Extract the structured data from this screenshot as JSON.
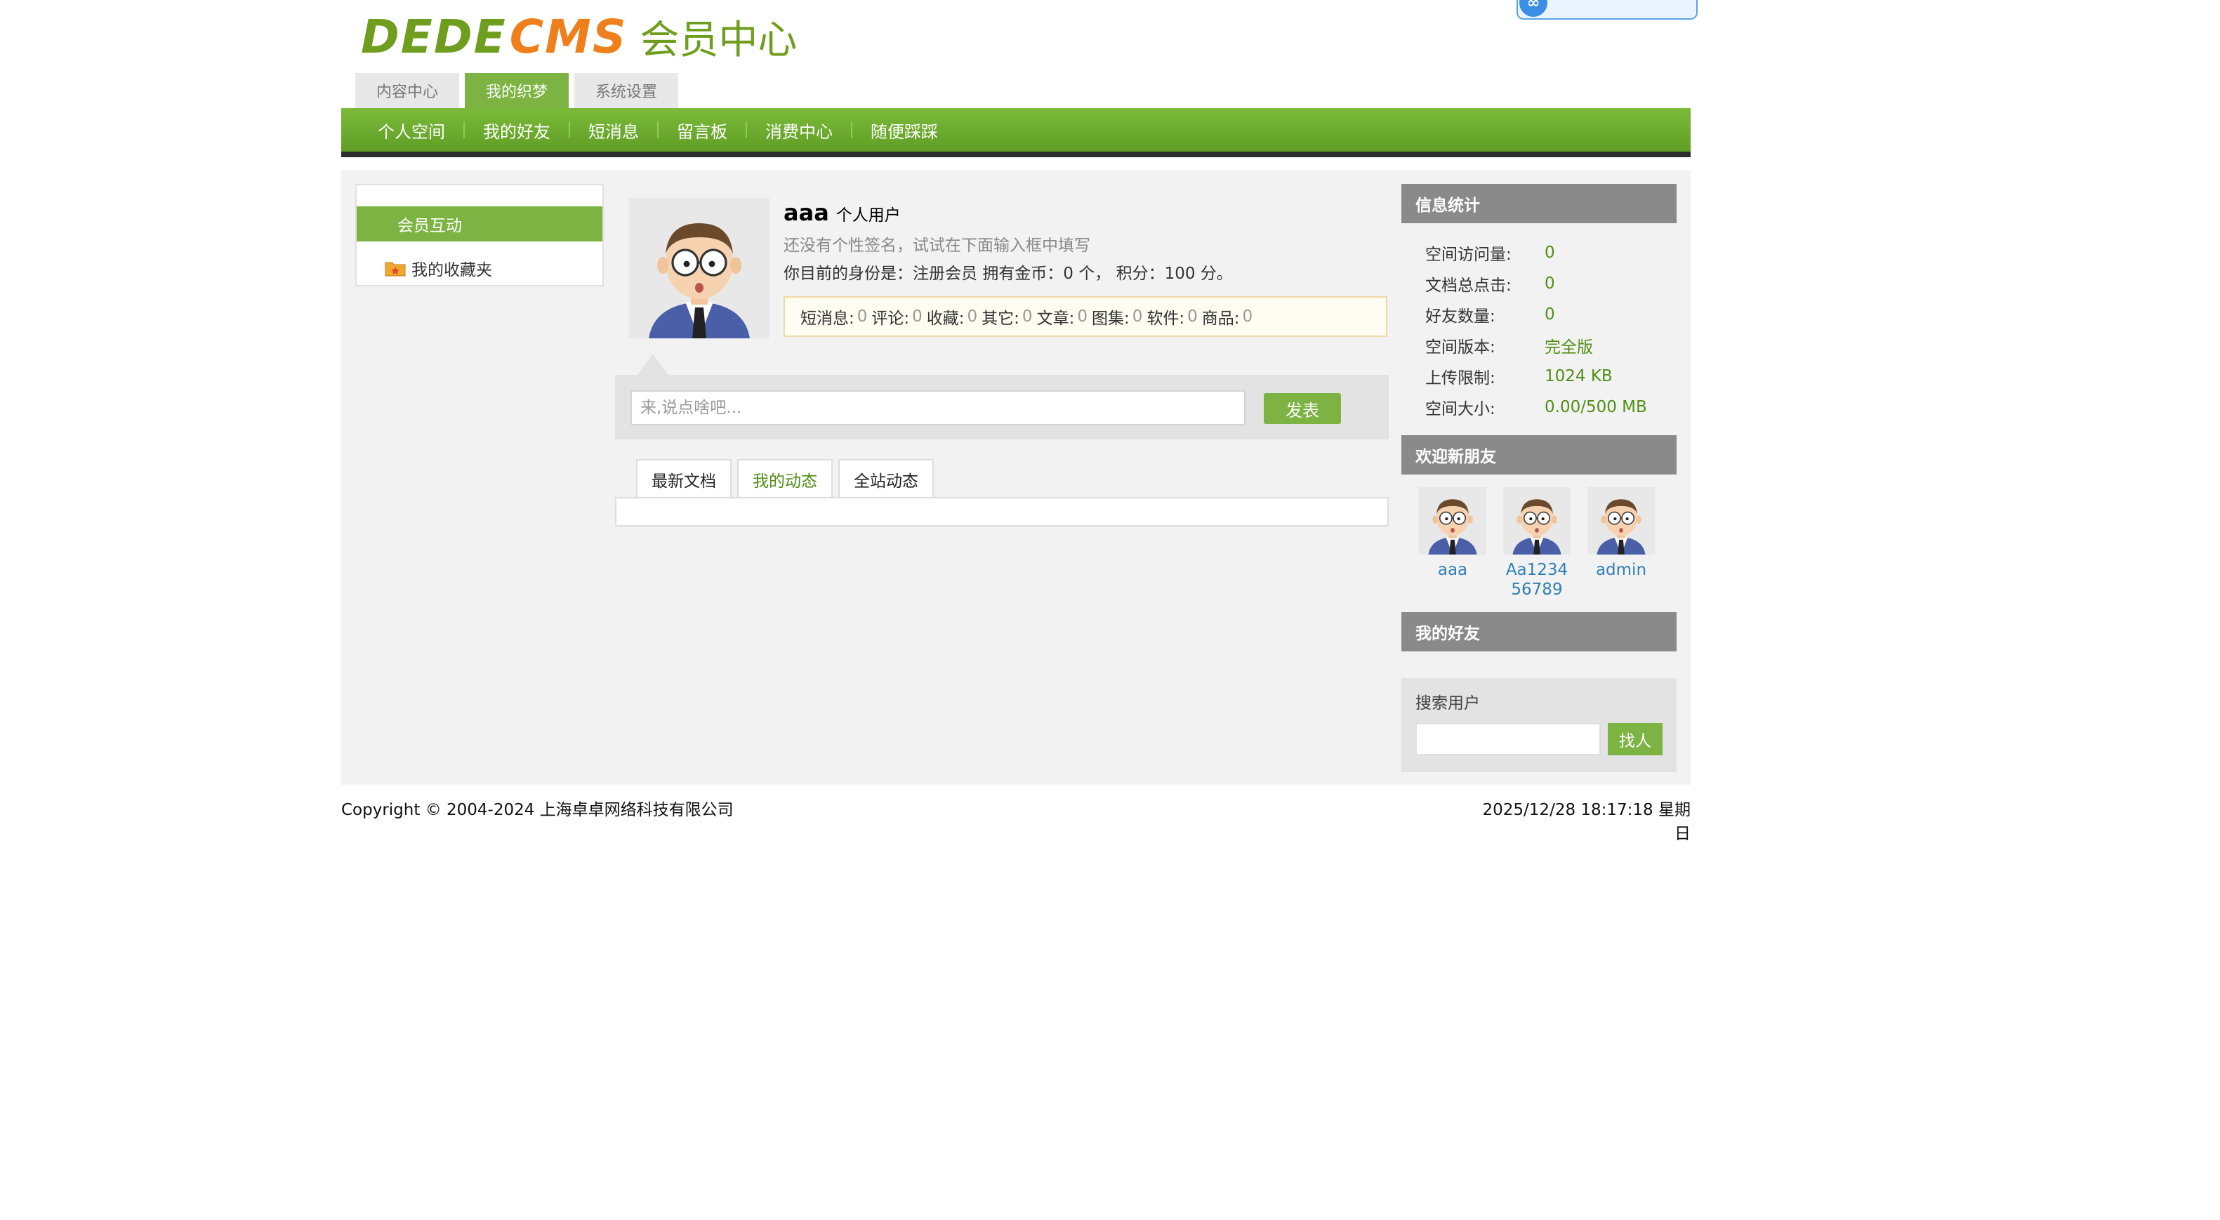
{
  "logo": {
    "part1": "DEDE",
    "part2": "CMS",
    "part3": "会员中心"
  },
  "top_tabs": [
    {
      "label": "内容中心",
      "active": false
    },
    {
      "label": "我的织梦",
      "active": true
    },
    {
      "label": "系统设置",
      "active": false
    }
  ],
  "nav": [
    "个人空间",
    "我的好友",
    "短消息",
    "留言板",
    "消费中心",
    "随便踩踩"
  ],
  "left_menu": {
    "header": "会员互动",
    "item": "我的收藏夹"
  },
  "profile": {
    "username": "aaa",
    "user_type": "个人用户",
    "signature": "还没有个性签名，试试在下面输入框中填写",
    "identity": "你目前的身份是：注册会员 拥有金币：0 个， 积分：100 分。",
    "stats": [
      {
        "label": "短消息:",
        "value": "0"
      },
      {
        "label": "评论:",
        "value": "0"
      },
      {
        "label": "收藏:",
        "value": "0"
      },
      {
        "label": "其它:",
        "value": "0"
      },
      {
        "label": "文章:",
        "value": "0"
      },
      {
        "label": "图集:",
        "value": "0"
      },
      {
        "label": "软件:",
        "value": "0"
      },
      {
        "label": "商品:",
        "value": "0"
      }
    ]
  },
  "post": {
    "placeholder": "来,说点啥吧...",
    "button": "发表"
  },
  "feed_tabs": [
    {
      "label": "最新文档",
      "active": false
    },
    {
      "label": "我的动态",
      "active": true
    },
    {
      "label": "全站动态",
      "active": false
    }
  ],
  "info_stats": {
    "title": "信息统计",
    "rows": [
      {
        "label": "空间访问量:",
        "value": "0"
      },
      {
        "label": "文档总点击:",
        "value": "0"
      },
      {
        "label": "好友数量:",
        "value": "0"
      },
      {
        "label": "空间版本:",
        "value": "完全版"
      },
      {
        "label": "上传限制:",
        "value": "1024 KB"
      },
      {
        "label": "空间大小:",
        "value": "0.00/500 MB"
      }
    ]
  },
  "new_friends": {
    "title": "欢迎新朋友",
    "users": [
      "aaa",
      "Aa123456789",
      "admin"
    ]
  },
  "my_friends": {
    "title": "我的好友"
  },
  "search": {
    "label": "搜索用户",
    "button": "找人"
  },
  "footer": {
    "copyright": "Copyright © 2004-2024 上海卓卓网络科技有限公司",
    "datetime": "2025/12/28 18:17:18 星期日"
  },
  "colors": {
    "brand_green": "#7cb342",
    "orange": "#ef7f1a",
    "link_blue": "#2f7fb3"
  }
}
